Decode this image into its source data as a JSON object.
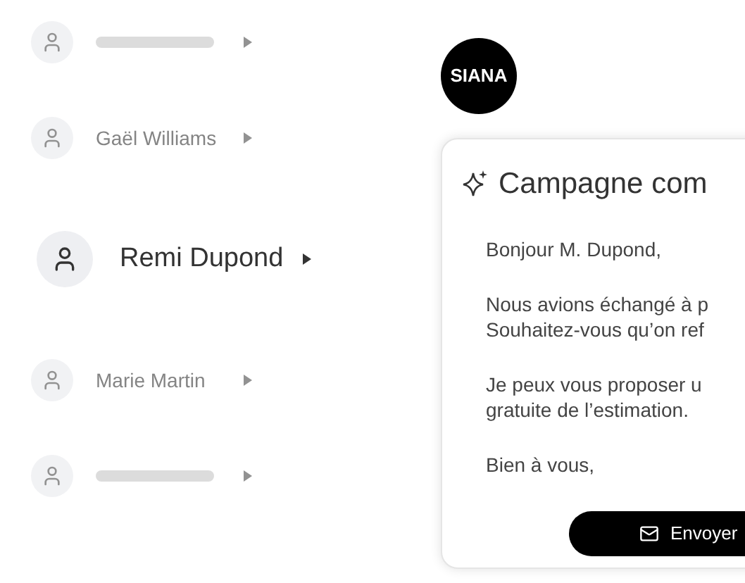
{
  "contacts": [
    {
      "kind": "obscured",
      "selected": false
    },
    {
      "kind": "named",
      "name": "Gaël Williams",
      "selected": false
    },
    {
      "kind": "named",
      "name": "Remi Dupond",
      "selected": true
    },
    {
      "kind": "named",
      "name": "Marie Martin",
      "selected": false
    },
    {
      "kind": "obscured",
      "selected": false
    }
  ],
  "logo": "SIANA",
  "card": {
    "title": "Campagne com",
    "paragraphs": [
      [
        "Bonjour M. Dupond,"
      ],
      [
        "Nous avions échangé à p",
        "Souhaitez-vous qu’on ref"
      ],
      [
        "Je peux vous proposer u",
        "gratuite de l’estimation."
      ],
      [
        "Bien à vous,"
      ]
    ],
    "button": "Envoyer"
  }
}
